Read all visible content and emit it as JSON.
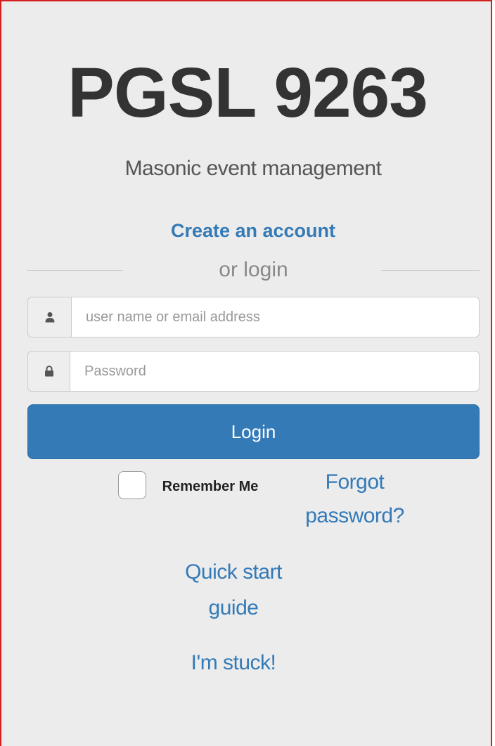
{
  "header": {
    "title": "PGSL 9263",
    "subtitle": "Masonic event management"
  },
  "links": {
    "create_account": "Create an account",
    "forgot_password": "Forgot password?",
    "quick_start": "Quick start guide",
    "stuck": "I'm stuck!"
  },
  "divider": {
    "text": "or login"
  },
  "form": {
    "username": {
      "placeholder": "user name or email address",
      "value": "",
      "icon": "user-icon"
    },
    "password": {
      "placeholder": "Password",
      "value": "",
      "icon": "lock-icon"
    },
    "login_label": "Login",
    "remember_label": "Remember Me",
    "remember_checked": false
  },
  "colors": {
    "link": "#337ab7",
    "primary_button": "#337ab7",
    "background": "#ececec",
    "frame_border": "#d41f1f"
  }
}
